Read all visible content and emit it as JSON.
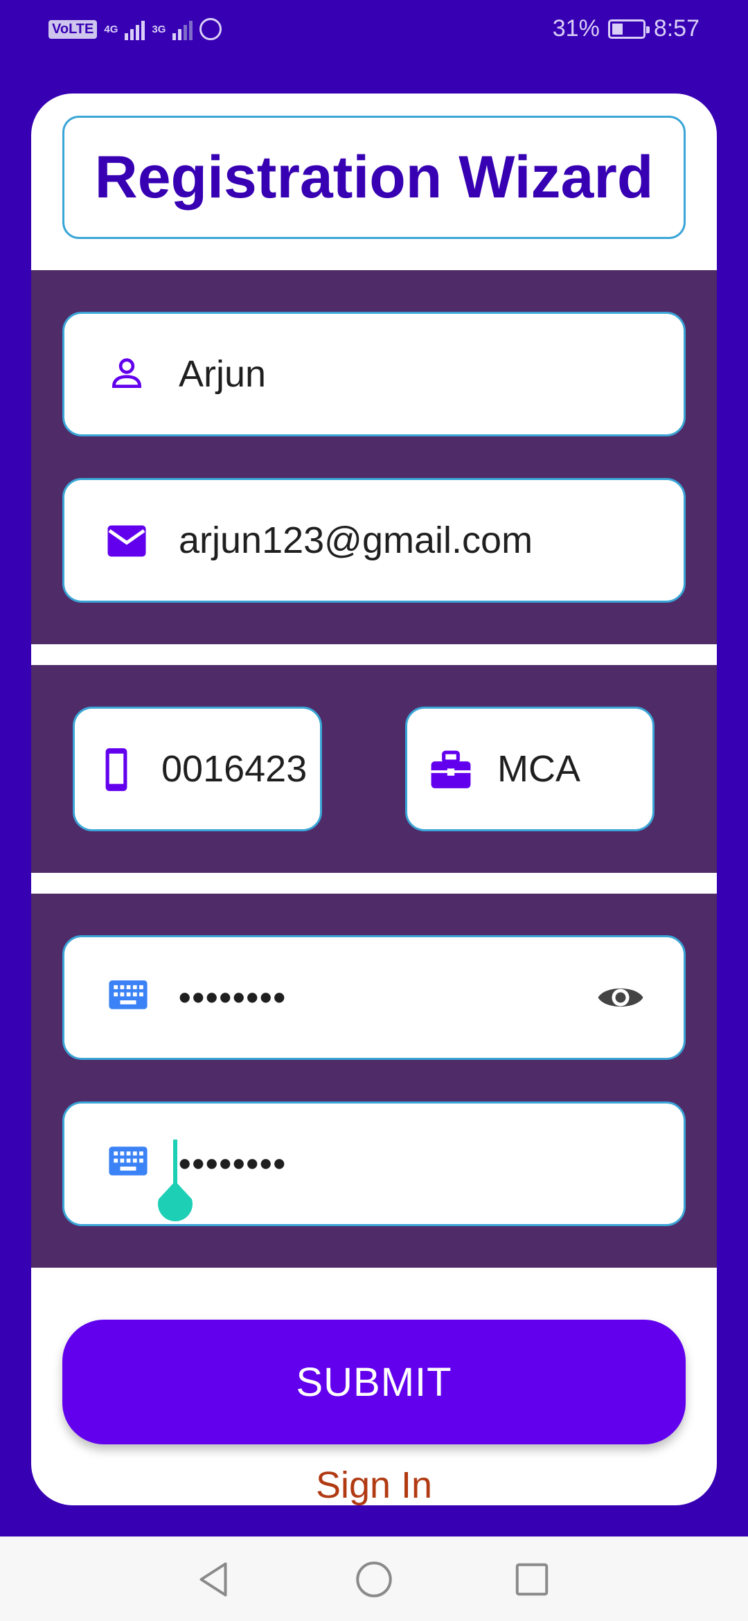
{
  "status_bar": {
    "volte": "VoLTE",
    "sim1_network": "4G",
    "sim2_network": "3G",
    "battery_percent": "31%",
    "battery_level": 0.31,
    "time": "8:57",
    "icons": [
      "volte-icon",
      "signal-icon",
      "whatsapp-icon",
      "battery-icon"
    ]
  },
  "app": {
    "title": "Registration Wizard",
    "colors": {
      "background": "#3700B3",
      "title": "#3700B3",
      "panel": "#4F2B68",
      "field_border": "#3AA5D6",
      "accent": "#6200EE",
      "sign_in": "#B13A12",
      "cursor_handle": "#1DCFB5"
    }
  },
  "form": {
    "name": {
      "value": "Arjun",
      "icon": "person-icon"
    },
    "email": {
      "value": "arjun123@gmail.com",
      "icon": "email-icon"
    },
    "phone": {
      "value": "0016423",
      "icon": "phone-icon"
    },
    "degree": {
      "value": "MCA",
      "icon": "briefcase-icon"
    },
    "password": {
      "value": "••••••••",
      "icon": "keyboard-icon",
      "toggle_icon": "eye-icon"
    },
    "confirm_password": {
      "value": "••••••••",
      "icon": "keyboard-icon"
    }
  },
  "actions": {
    "submit_label": "SUBMIT",
    "sign_in_label": "Sign In"
  },
  "nav_bar": {
    "icons": [
      "back-icon",
      "home-icon",
      "recents-icon"
    ]
  }
}
